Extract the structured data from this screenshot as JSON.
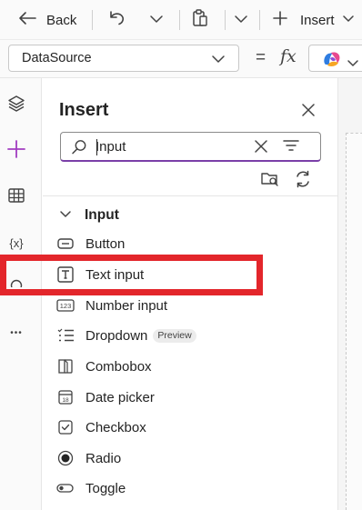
{
  "commandbar": {
    "back_label": "Back",
    "insert_label": "Insert"
  },
  "formula": {
    "property_value": "DataSource",
    "equals": "=",
    "fx_label": "fx"
  },
  "rail": {
    "variables_label": "{x}",
    "more_label": "•••"
  },
  "insert_panel": {
    "title": "Insert",
    "search": {
      "value": "Input",
      "placeholder": "Search"
    },
    "group": {
      "label": "Input",
      "items": [
        {
          "label": "Button",
          "icon": "button-icon"
        },
        {
          "label": "Text input",
          "icon": "text-input-icon"
        },
        {
          "label": "Number input",
          "icon": "number-input-icon"
        },
        {
          "label": "Dropdown",
          "icon": "dropdown-icon",
          "badge": "Preview"
        },
        {
          "label": "Combobox",
          "icon": "combobox-icon"
        },
        {
          "label": "Date picker",
          "icon": "calendar-icon"
        },
        {
          "label": "Checkbox",
          "icon": "checkbox-icon"
        },
        {
          "label": "Radio",
          "icon": "radio-icon"
        },
        {
          "label": "Toggle",
          "icon": "toggle-icon"
        }
      ]
    }
  },
  "colors": {
    "accent": "#7a3fa8",
    "add_accent": "#a23cc1",
    "highlight": "#e3262b"
  }
}
